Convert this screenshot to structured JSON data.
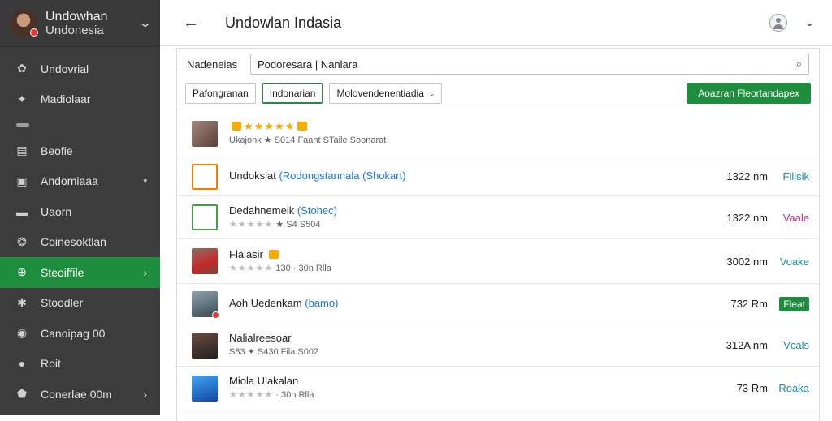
{
  "sidebar": {
    "user_line1": "Undowhan",
    "user_line2": "Undonesia",
    "items": [
      {
        "label": "Undovrial",
        "icon": "flower-icon"
      },
      {
        "label": "Madiolaar",
        "icon": "pin-icon"
      },
      {
        "label": "Beofie",
        "icon": "document-icon"
      },
      {
        "label": "Andomiaaa",
        "icon": "briefcase-icon",
        "extra": "▾"
      },
      {
        "label": "Uaorn",
        "icon": "panel-icon"
      },
      {
        "label": "Coinesoktlan",
        "icon": "group-icon"
      },
      {
        "label": "Steoiffile",
        "icon": "globe-icon",
        "active": true,
        "extra": "›"
      },
      {
        "label": "Stoodler",
        "icon": "settings-icon"
      },
      {
        "label": "Canoipag 00",
        "icon": "location-icon"
      },
      {
        "label": "Roit",
        "icon": "person-icon"
      },
      {
        "label": "Conerlae 00m",
        "icon": "shield-icon",
        "extra": "›"
      }
    ]
  },
  "topbar": {
    "back_icon": "←",
    "title": "Undowlan Indasia",
    "chevron": "⌄"
  },
  "search": {
    "label": "Nadeneias",
    "value": "Podoresara | Nanlara",
    "icon": "⌕"
  },
  "filters": {
    "chips": [
      "Pafongranan",
      "Indonarian",
      "Molovendenentiadia"
    ],
    "primary_button": "Aoazran Fleortandapex",
    "dropdown_glyph": "⌄"
  },
  "colors": {
    "accent": "#1e8e3e",
    "sidebar_bg": "#3c3c3c",
    "link": "#1a73e8",
    "teal": "#1a8ba0",
    "purple": "#b0338b"
  },
  "rows": [
    {
      "name": "",
      "paren": "",
      "meta": "Ukajonk ★ S014 Faant STaile Soonarat",
      "stars": "★★★★★",
      "distance": "",
      "action": "",
      "thumb_color": "#8d6e63"
    },
    {
      "name": "Undokslat",
      "paren": "(Rodongstannala (Shokart)",
      "meta": "",
      "stars": "",
      "distance": "1322 nm",
      "action": "Fillsik",
      "action_style": "teal",
      "thumb_color": "#f57c00"
    },
    {
      "name": "Dedahnemeik",
      "paren": "(Stohec)",
      "meta": "★ S4 S504",
      "stars": "★★★★★",
      "distance": "1322 nm",
      "action": "Vaale",
      "action_style": "purple",
      "thumb_color": "#2e7d32"
    },
    {
      "name": "Flalasir",
      "paren": "",
      "meta": "130 · 30n Rlla",
      "stars": "★★★★★",
      "distance": "3002 nm",
      "action": "Voake",
      "action_style": "teal",
      "thumb_color": "#795548"
    },
    {
      "name": "Aoh Uedenkam",
      "paren": "(bamo)",
      "meta": "",
      "stars": "",
      "distance": "732 Rm",
      "action": "Fleat",
      "action_style": "green-pill",
      "thumb_color": "#5d7b8a"
    },
    {
      "name": "Nalialreesoar",
      "paren": "",
      "meta": "S83 ✦ S430 Fila S002",
      "stars": "",
      "distance": "312A nm",
      "action": "Vcals",
      "action_style": "teal",
      "thumb_color": "#4e342e"
    },
    {
      "name": "Miola Ulakalan",
      "paren": "",
      "meta": "· 30n Rlla",
      "stars": "★★★★★",
      "distance": "73 Rm",
      "action": "Roaka",
      "action_style": "teal",
      "thumb_color": "#1565c0"
    }
  ]
}
